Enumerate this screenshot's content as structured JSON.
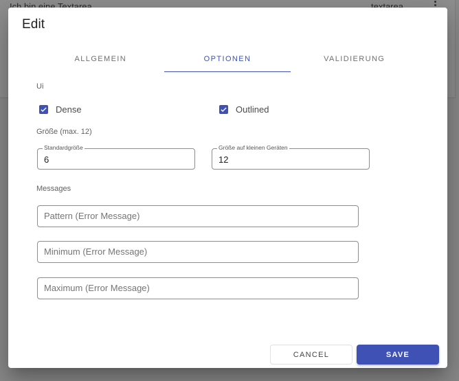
{
  "background": {
    "row_text": "Ich bin eine Textarea",
    "row_type": "textarea",
    "menu_icon": "kebab-vertical-icon"
  },
  "dialog": {
    "title": "Edit",
    "tabs": [
      {
        "label": "ALLGEMEIN",
        "active": false
      },
      {
        "label": "OPTIONEN",
        "active": true
      },
      {
        "label": "VALIDIERUNG",
        "active": false
      }
    ],
    "ui_section": {
      "label": "Ui",
      "checkboxes": [
        {
          "label": "Dense",
          "checked": true
        },
        {
          "label": "Outlined",
          "checked": true
        }
      ]
    },
    "size_section": {
      "label": "Größe (max. 12)",
      "fields": [
        {
          "label": "Standardgröße",
          "value": "6"
        },
        {
          "label": "Größe auf kleinen Geräten",
          "value": "12"
        }
      ]
    },
    "messages_section": {
      "label": "Messages",
      "fields": [
        {
          "placeholder": "Pattern (Error Message)",
          "value": ""
        },
        {
          "placeholder": "Minimum (Error Message)",
          "value": ""
        },
        {
          "placeholder": "Maximum (Error Message)",
          "value": ""
        }
      ]
    },
    "actions": {
      "cancel_label": "CANCEL",
      "save_label": "SAVE"
    }
  },
  "colors": {
    "primary": "#3f51b5",
    "scrim": "#8a8a8a"
  }
}
